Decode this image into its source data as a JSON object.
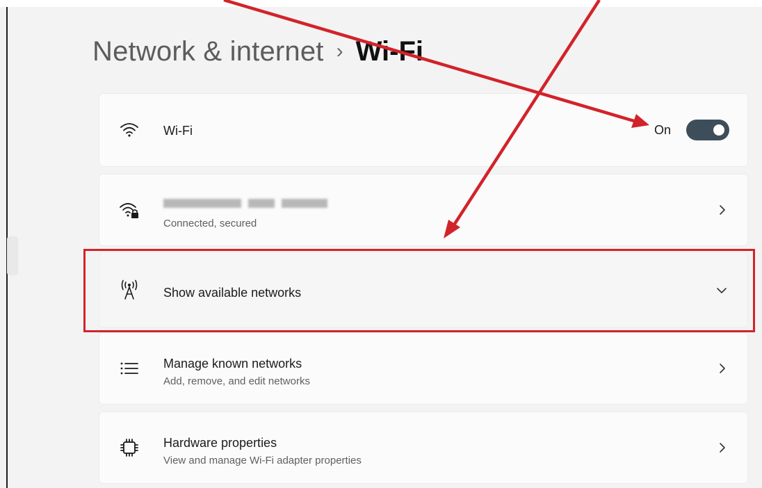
{
  "breadcrumb": {
    "parent": "Network & internet",
    "separator": "›",
    "current": "Wi-Fi"
  },
  "wifi": {
    "icon": "wifi-icon",
    "label": "Wi-Fi",
    "toggle_state": "On",
    "enabled": true
  },
  "connected_network": {
    "icon": "wifi-secured-icon",
    "name_blurred": true,
    "status": "Connected, secured",
    "chevron": "chevron-right-icon"
  },
  "show_networks": {
    "icon": "antenna-icon",
    "label": "Show available networks",
    "chevron": "chevron-down-icon"
  },
  "manage_networks": {
    "icon": "list-icon",
    "label": "Manage known networks",
    "description": "Add, remove, and edit networks",
    "chevron": "chevron-right-icon"
  },
  "hardware": {
    "icon": "chip-icon",
    "label": "Hardware properties",
    "description": "View and manage Wi-Fi adapter properties",
    "chevron": "chevron-right-icon"
  },
  "colors": {
    "toggle_on": "#3d4e5a",
    "annotation_red": "#d2232a",
    "card_bg": "#fbfbfb",
    "page_bg": "#f3f3f3"
  }
}
